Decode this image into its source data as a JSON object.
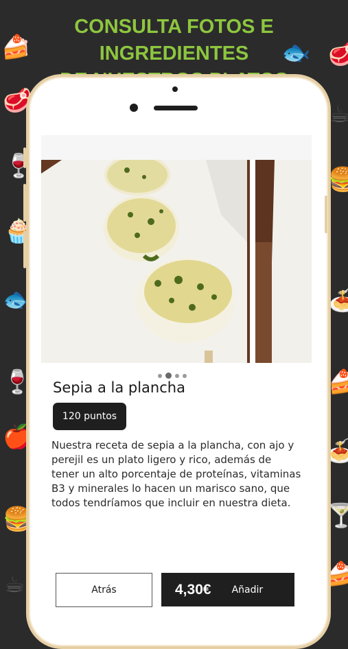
{
  "promo": {
    "headline_line1": "CONSULTA FOTOS E INGREDIENTES",
    "headline_line2": "DE NUESTROS PLATOS"
  },
  "background_icons": [
    "cake-icon",
    "fish-icon",
    "steak-icon",
    "wine-glass-icon",
    "cupcake-icon",
    "cocktail-icon",
    "pasta-icon",
    "apple-icon",
    "coffee-icon",
    "burger-icon"
  ],
  "dish": {
    "name": "Sepia a la plancha",
    "points": "120 puntos",
    "description": "Nuestra receta de sepia a la plancha, con ajo y perejil es un plato ligero y rico, además de tener un alto porcentaje de proteínas, vitaminas B3 y minerales lo hacen un marisco sano, que todos tendríamos que incluir en nuestra dieta.",
    "photo_count": 4,
    "active_photo": 2
  },
  "actions": {
    "back_label": "Atrás",
    "price": "4,30€",
    "add_label": "Añadir"
  },
  "colors": {
    "background": "#2b2b2b",
    "headline": "#8dc63f",
    "phone_frame": "#e6cfa5",
    "button_dark": "#1f1f1f"
  }
}
